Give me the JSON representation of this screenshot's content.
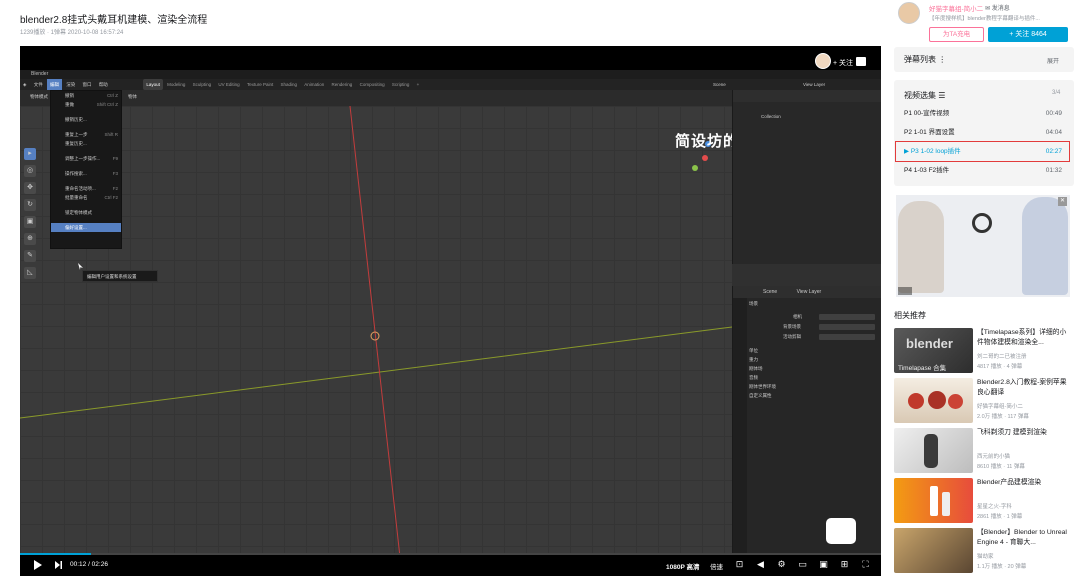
{
  "video": {
    "title": "blender2.8挂式头戴耳机建模、渲染全流程",
    "meta": "1239播放 · 1弹幕   2020-10-08 16:57:24"
  },
  "player": {
    "overlay_follow": "+ 关注",
    "watermark": "简设坊的简小二",
    "watermark_logo": "bilibili",
    "time": "00:12 / 02:26",
    "quality": "1080P 高清",
    "speed": "倍速",
    "progress": 0.082,
    "colors": {
      "accent": "#00a1d6",
      "pink": "#fb7299"
    }
  },
  "blender": {
    "window_title": "Blender",
    "menu": [
      "文件",
      "编辑",
      "渲染",
      "窗口",
      "帮助"
    ],
    "workspaces": [
      "Layout",
      "Modeling",
      "Sculpting",
      "UV Editing",
      "Texture Paint",
      "Shading",
      "Animation",
      "Rendering",
      "Compositing",
      "Scripting",
      "+"
    ],
    "active_workspace": "Layout",
    "scene_label": "Scene",
    "view_layer_label": "View Layer",
    "object_mode": "物体模式",
    "object_label": "物体",
    "edit_menu": [
      {
        "label": "撤销",
        "shortcut": "Ctrl Z"
      },
      {
        "label": "重做",
        "shortcut": "Shift Ctrl Z"
      },
      {
        "label": "撤销历史...",
        "shortcut": ""
      },
      {
        "label": "重复上一步",
        "shortcut": "Shift R"
      },
      {
        "label": "重复历史...",
        "shortcut": ""
      },
      {
        "label": "调整上一步操作...",
        "shortcut": "F9"
      },
      {
        "label": "操作搜索...",
        "shortcut": "F3"
      },
      {
        "label": "重命名活动项...",
        "shortcut": "F2"
      },
      {
        "label": "批量重命名",
        "shortcut": "Ctrl F2"
      },
      {
        "label": "锁定物体模式",
        "shortcut": ""
      },
      {
        "label": "偏好设置...",
        "shortcut": ""
      }
    ],
    "tooltip": "编辑用户设置和系统设置",
    "outliner_collection": "Collection",
    "props_scene": "Scene",
    "props_view_layer": "View Layer",
    "props_section": "场景",
    "props_rows": [
      "相机",
      "背景场景",
      "活动剪辑"
    ],
    "props_sections": [
      "单位",
      "重力",
      "刚体场",
      "音频",
      "刚体世界环境",
      "自定义属性"
    ],
    "status_left": [
      "选择",
      "框选",
      "旋转视图",
      "物体上下文菜单"
    ],
    "status_right": "Collection | 立方 | 点:8 | 三角面:12 | 物体:0/3 | 内存: 40.0 MiB | 2.83.7"
  },
  "sidebar": {
    "uploader_name": "好猫字幕组-简小二",
    "send_msg": "发消息",
    "uploader_desc": "【年度搜样机】blender教程字幕翻译与插件...",
    "charge": "为TA充电",
    "follow": "+ 关注 8464",
    "danmu_list": "弹幕列表",
    "danmu_expand": "展开",
    "playlist_title": "视频选集",
    "playlist_count": "3/4",
    "playlist": [
      {
        "label": "P1  00-宣传视频",
        "duration": "00:49"
      },
      {
        "label": "P2  1-01 界面设置",
        "duration": "04:04"
      },
      {
        "label": "P3  1-02 loop插件",
        "duration": "02:27"
      },
      {
        "label": "P4  1-03 F2插件",
        "duration": "01:32"
      }
    ],
    "current_index": 2,
    "recommend_title": "相关推荐",
    "recommendations": [
      {
        "title": "【Timelapase系列】详细的小件物体建模和渲染全...",
        "uploader": "刘二哥的二已被注册",
        "stats": "4817 播放 · 4 弹幕",
        "thumb_text": "blender",
        "thumb_sub": "Timelapase 合集"
      },
      {
        "title": "Blender2.8入门教程-案例苹果 良心翻译",
        "uploader": "好猫字幕组-简小二",
        "stats": "2.0万 播放 · 117 弹幕",
        "thumb_text": "",
        "thumb_sub": ""
      },
      {
        "title": "飞科剃须刀 建模到渲染",
        "uploader": "西元前的小猫",
        "stats": "8610 播放 · 11 弹幕",
        "thumb_text": "",
        "thumb_sub": ""
      },
      {
        "title": "Blender产品建模渲染",
        "uploader": "星星之火-字科",
        "stats": "2861 播放 · 1 弹幕",
        "thumb_text": "",
        "thumb_sub": ""
      },
      {
        "title": "【Blender】Blender to Unreal Engine 4 - 育聯大...",
        "uploader": "猫劫家",
        "stats": "1.1万 播放 · 20 弹幕",
        "thumb_text": "",
        "thumb_sub": ""
      }
    ]
  }
}
